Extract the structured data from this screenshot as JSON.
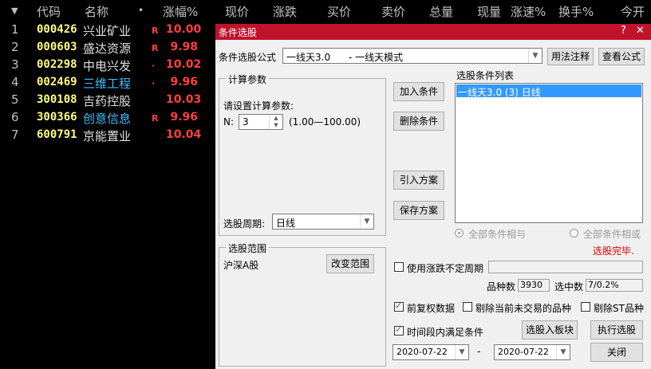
{
  "table": {
    "headers": [
      "代码",
      "名称",
      "•",
      "涨幅%",
      "现价",
      "涨跌",
      "买价",
      "卖价",
      "总量",
      "现量",
      "涨速%",
      "换手%",
      "今开"
    ],
    "rows": [
      {
        "idx": "1",
        "code": "000426",
        "name": "兴业矿业",
        "name_color": "#e0e0e0",
        "flag": "R",
        "pct": "10.00"
      },
      {
        "idx": "2",
        "code": "000603",
        "name": "盛达资源",
        "name_color": "#e0e0e0",
        "flag": "R",
        "pct": "9.98"
      },
      {
        "idx": "3",
        "code": "002298",
        "name": "中电兴发",
        "name_color": "#e0e0e0",
        "flag": "·",
        "pct": "10.02"
      },
      {
        "idx": "4",
        "code": "002469",
        "name": "三维工程",
        "name_color": "#40c0ff",
        "flag": "·",
        "pct": "9.96"
      },
      {
        "idx": "5",
        "code": "300108",
        "name": "吉药控股",
        "name_color": "#e0e0e0",
        "flag": "",
        "pct": "10.03"
      },
      {
        "idx": "6",
        "code": "300366",
        "name": "创意信息",
        "name_color": "#40c0ff",
        "flag": "R",
        "pct": "9.96"
      },
      {
        "idx": "7",
        "code": "600791",
        "name": "京能置业",
        "name_color": "#e0e0e0",
        "flag": "",
        "pct": "10.04"
      }
    ],
    "sort_arrow": "▼"
  },
  "dialog": {
    "title": "条件选股",
    "help_btn": "?",
    "close_btn": "✕",
    "formula_label": "条件选股公式",
    "formula_value": "一线天3.0      - 一线天模式",
    "usage_btn": "用法注释",
    "view_formula_btn": "查看公式",
    "calc_params_title": "计算参数",
    "set_params_label": "请设置计算参数:",
    "param_n_label": "N:",
    "param_n_value": "3",
    "param_range": "(1.00—100.00)",
    "period_label": "选股周期:",
    "period_value": "日线",
    "add_cond_btn": "加入条件",
    "del_cond_btn": "删除条件",
    "import_btn": "引入方案",
    "save_btn": "保存方案",
    "cond_list_label": "选股条件列表",
    "cond_list_items": [
      "一线天3.0 (3) 日线"
    ],
    "all_and": "全部条件相与",
    "all_or": "全部条件相或",
    "range_title": "选股范围",
    "range_value": "沪深A股",
    "change_range_btn": "改变范围",
    "status_done": "选股完毕.",
    "use_uncertain_period": "使用涨跌不定周期",
    "count_label": "品种数",
    "count_value": "3930",
    "selected_label": "选中数",
    "selected_value": "7/0.2%",
    "prev_adjust": "前复权数据",
    "exclude_untraded": "剔除当前未交易的品种",
    "exclude_st": "剔除ST品种",
    "time_range_cond": "时间段内满足条件",
    "to_block_btn": "选股入板块",
    "run_btn": "执行选股",
    "date_from": "2020-07-22",
    "date_sep": "-",
    "date_to": "2020-07-22",
    "close_dialog_btn": "关闭"
  }
}
